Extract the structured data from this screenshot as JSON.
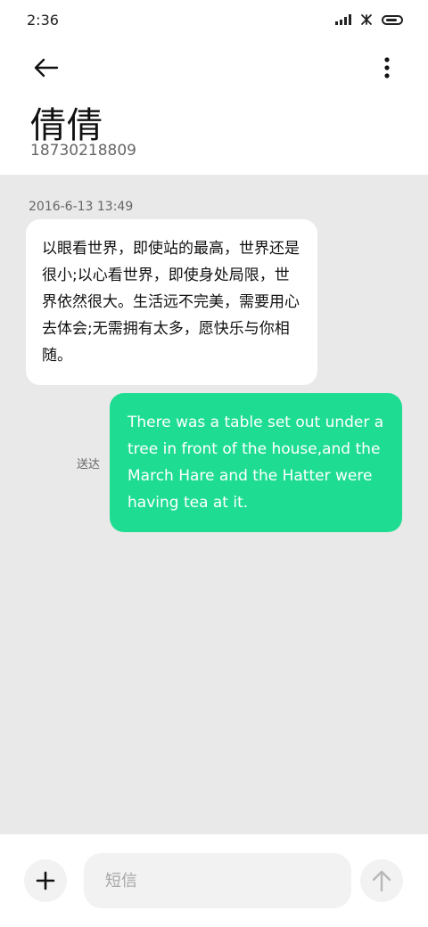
{
  "status_bar": {
    "time": "2:36",
    "icons": [
      "signal-icon",
      "wifi-off-icon",
      "battery-icon"
    ]
  },
  "header": {
    "back_icon": "back-arrow-icon",
    "more_icon": "more-vertical-icon",
    "contact_name": "倩倩",
    "contact_number": "18730218809"
  },
  "conversation": {
    "timestamp": "2016-6-13 13:49",
    "messages": [
      {
        "direction": "incoming",
        "text": "以眼看世界，即使站的最高，世界还是很小;以心看世界，即使身处局限，世界依然很大。生活远不完美，需要用心去体会;无需拥有太多，愿快乐与你相随。"
      },
      {
        "direction": "outgoing",
        "text": "There was a table set out under a tree in front of the house,and the March Hare and the Hatter were having tea at it.",
        "status": "送达"
      }
    ]
  },
  "composer": {
    "add_icon": "plus-icon",
    "input_placeholder": "短信",
    "input_value": "",
    "send_icon": "send-arrow-up-icon"
  },
  "colors": {
    "outgoing_bubble": "#1edd93",
    "incoming_bubble": "#ffffff",
    "chat_background": "#e8e9e8"
  }
}
